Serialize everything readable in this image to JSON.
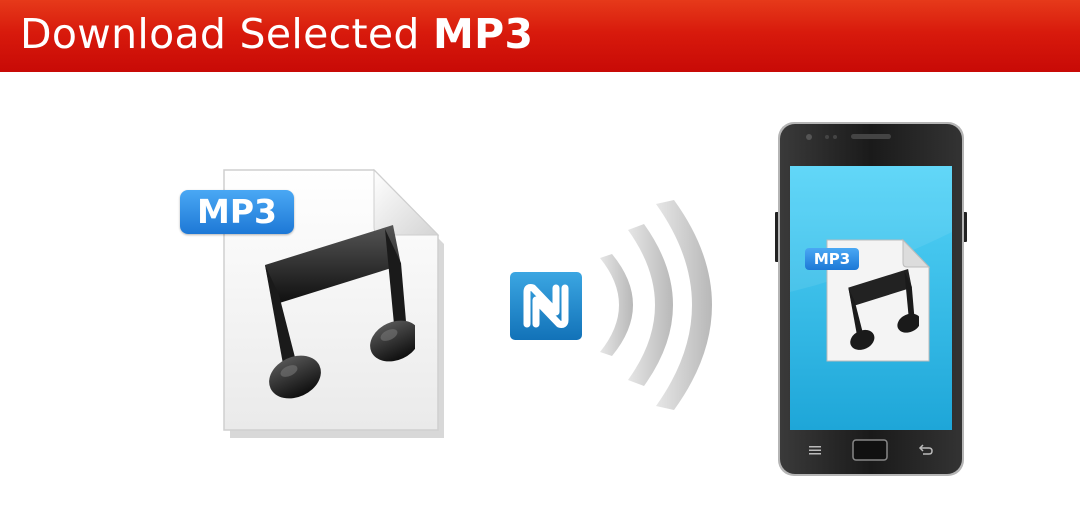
{
  "header": {
    "title_prefix": "Download Selected",
    "title_emphasis": "MP3"
  },
  "file_icon": {
    "badge_label": "MP3",
    "icon": "music-note-icon"
  },
  "transfer": {
    "nfc_icon": "nfc-n-mark-icon",
    "signal_icon": "wireless-signal-waves-icon"
  },
  "phone": {
    "screen_file_badge_label": "MP3",
    "screen_icon": "music-note-icon",
    "menu_icon": "menu-icon",
    "back_icon": "back-arrow-icon"
  },
  "colors": {
    "banner_red": "#d81a0c",
    "badge_blue": "#2a8ee8",
    "nfc_blue": "#1e88cc",
    "screen_cyan": "#2ec4ec"
  }
}
